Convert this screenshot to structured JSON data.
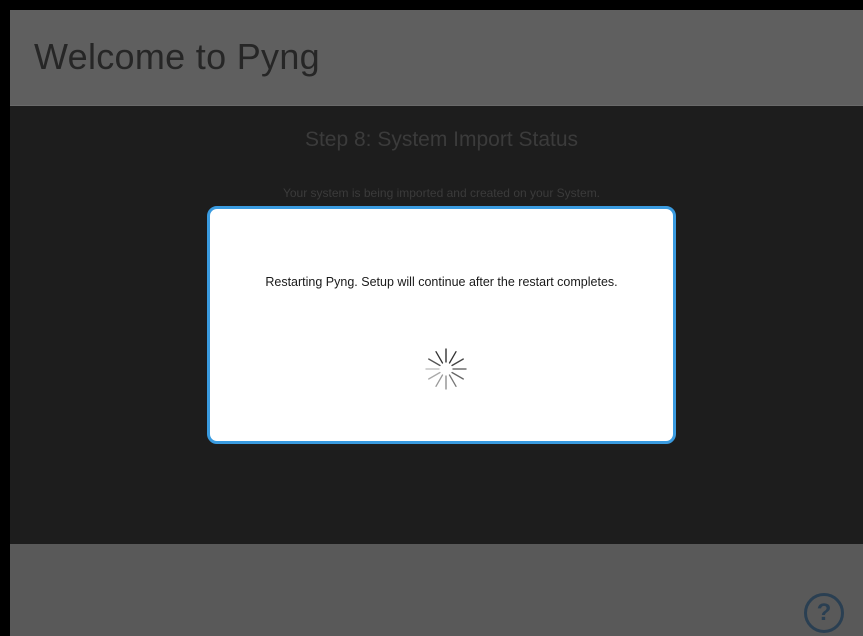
{
  "header": {
    "title": "Welcome to Pyng"
  },
  "step": {
    "title": "Step 8: System Import Status",
    "description": "Your system is being imported and created on your System."
  },
  "dialog": {
    "message": "Restarting Pyng. Setup will continue after the restart completes.",
    "spinner_icon": "loading-spinner-icon",
    "border_color": "#3a9be0"
  },
  "footer": {
    "help_label": "?",
    "help_icon": "help-icon"
  }
}
